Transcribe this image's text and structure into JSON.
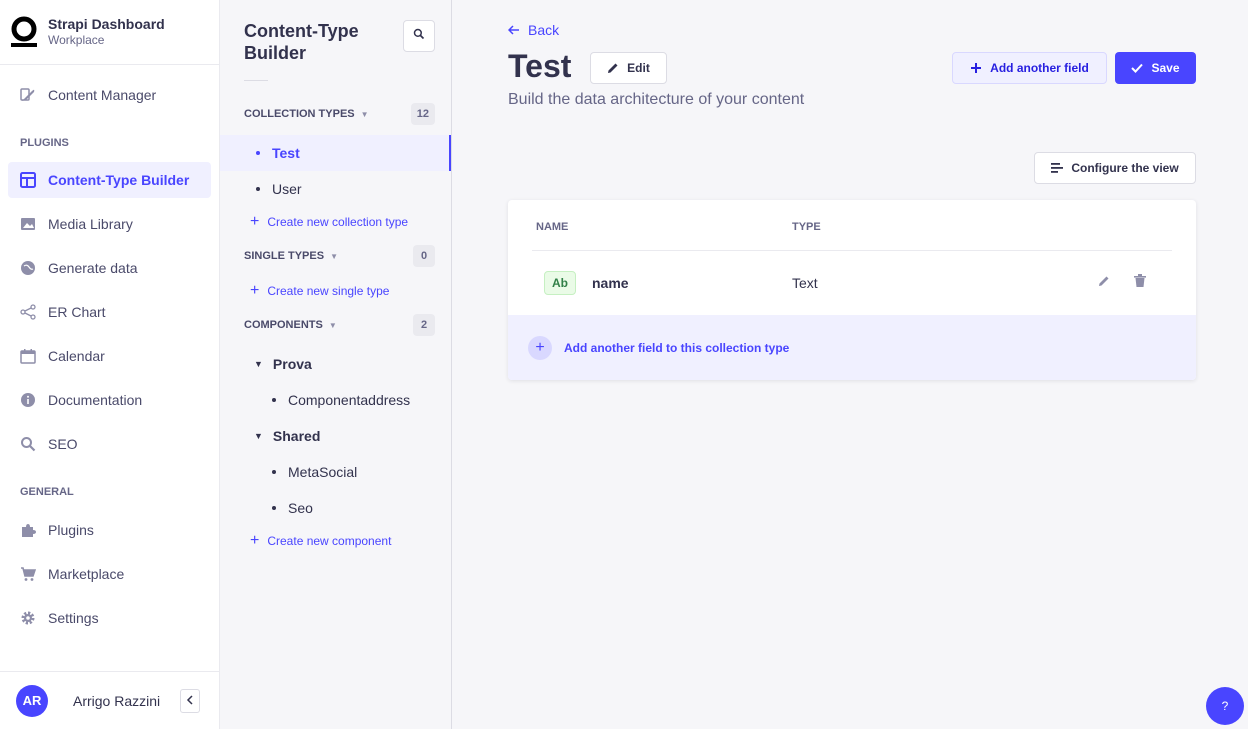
{
  "brand": {
    "title": "Strapi Dashboard",
    "subtitle": "Workplace"
  },
  "mainnav": {
    "content_manager": "Content Manager",
    "plugins_heading": "PLUGINS",
    "plugins": [
      "Content-Type Builder",
      "Media Library",
      "Generate data",
      "ER Chart",
      "Calendar",
      "Documentation",
      "SEO"
    ],
    "general_heading": "GENERAL",
    "general": [
      "Plugins",
      "Marketplace",
      "Settings"
    ]
  },
  "profile": {
    "initials": "AR",
    "name": "Arrigo Razzini"
  },
  "subnav": {
    "title_line1": "Content-Type",
    "title_line2": "Builder",
    "collection_heading": "COLLECTION TYPES",
    "collection_count": "12",
    "collection_items": [
      "Test",
      "User"
    ],
    "create_collection": "Create new collection type",
    "single_heading": "SINGLE TYPES",
    "single_count": "0",
    "create_single": "Create new single type",
    "components_heading": "COMPONENTS",
    "components_count": "2",
    "groups": [
      {
        "name": "Prova",
        "items": [
          "Componentaddress"
        ]
      },
      {
        "name": "Shared",
        "items": [
          "MetaSocial",
          "Seo"
        ]
      }
    ],
    "create_component": "Create new component"
  },
  "header": {
    "back": "Back",
    "title": "Test",
    "edit": "Edit",
    "add_field": "Add another field",
    "save": "Save",
    "subtitle": "Build the data architecture of your content",
    "configure": "Configure the view"
  },
  "table": {
    "col_name": "NAME",
    "col_type": "TYPE",
    "rows": [
      {
        "badge": "Ab",
        "name": "name",
        "type": "Text"
      }
    ],
    "add_footer": "Add another field to this collection type"
  },
  "help": "?",
  "colors": {
    "primary": "#4945ff",
    "primary_light": "#f0f0ff",
    "text": "#32324d",
    "muted": "#666687"
  }
}
